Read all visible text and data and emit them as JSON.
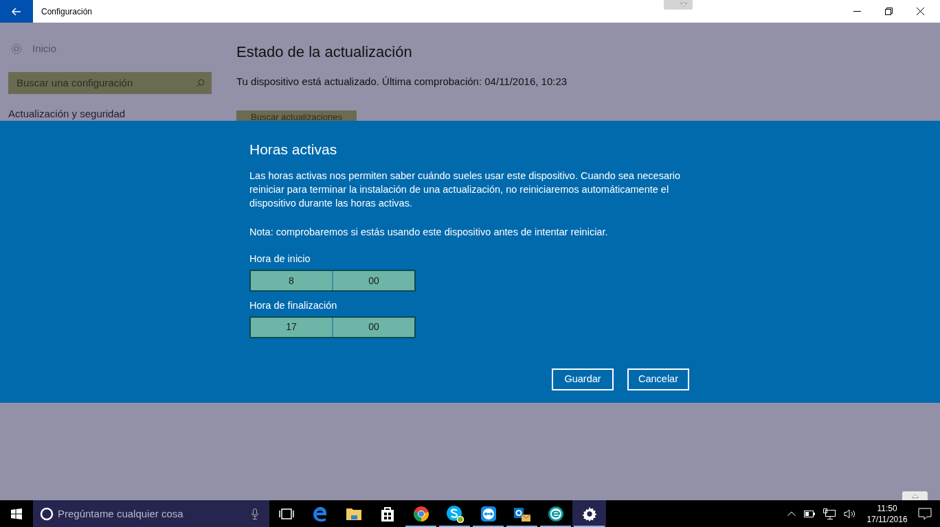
{
  "window": {
    "title": "Configuración"
  },
  "sidebar": {
    "home": "Inicio",
    "search": {
      "placeholder": "Buscar una configuración"
    },
    "section": "Actualización y seguridad"
  },
  "content": {
    "title": "Estado de la actualización",
    "status": "Tu dispositivo está actualizado. Última comprobación: 04/11/2016, 10:23",
    "button": "Buscar actualizaciones"
  },
  "dialog": {
    "title": "Horas activas",
    "description": "Las horas activas nos permiten saber cuándo sueles usar este dispositivo. Cuando sea necesario reiniciar para terminar la instalación de una actualización, no reiniciaremos automáticamente el dispositivo durante las horas activas.",
    "note": "Nota: comprobaremos si estás usando este dispositivo antes de intentar reiniciar.",
    "fields": [
      {
        "label": "Hora de inicio",
        "hour": "8",
        "minute": "00"
      },
      {
        "label": "Hora de finalización",
        "hour": "17",
        "minute": "00"
      }
    ],
    "buttons": [
      "Guardar",
      "Cancelar"
    ]
  },
  "taskbar": {
    "search": {
      "placeholder": "Pregúntame cualquier cosa"
    },
    "apps": [
      {
        "kind": "taskview",
        "running": false,
        "selected": false
      },
      {
        "kind": "edge",
        "running": false,
        "selected": false
      },
      {
        "kind": "explorer",
        "running": false,
        "selected": false
      },
      {
        "kind": "store",
        "running": false,
        "selected": false
      },
      {
        "kind": "chrome",
        "running": true,
        "selected": false
      },
      {
        "kind": "skype",
        "running": true,
        "selected": false
      },
      {
        "kind": "teamviewer",
        "running": true,
        "selected": false
      },
      {
        "kind": "outlook",
        "running": true,
        "selected": false
      },
      {
        "kind": "eset",
        "running": true,
        "selected": false
      },
      {
        "kind": "settings",
        "running": true,
        "selected": true
      }
    ],
    "clock": {
      "time": "11:50",
      "date": "17/11/2016"
    }
  }
}
